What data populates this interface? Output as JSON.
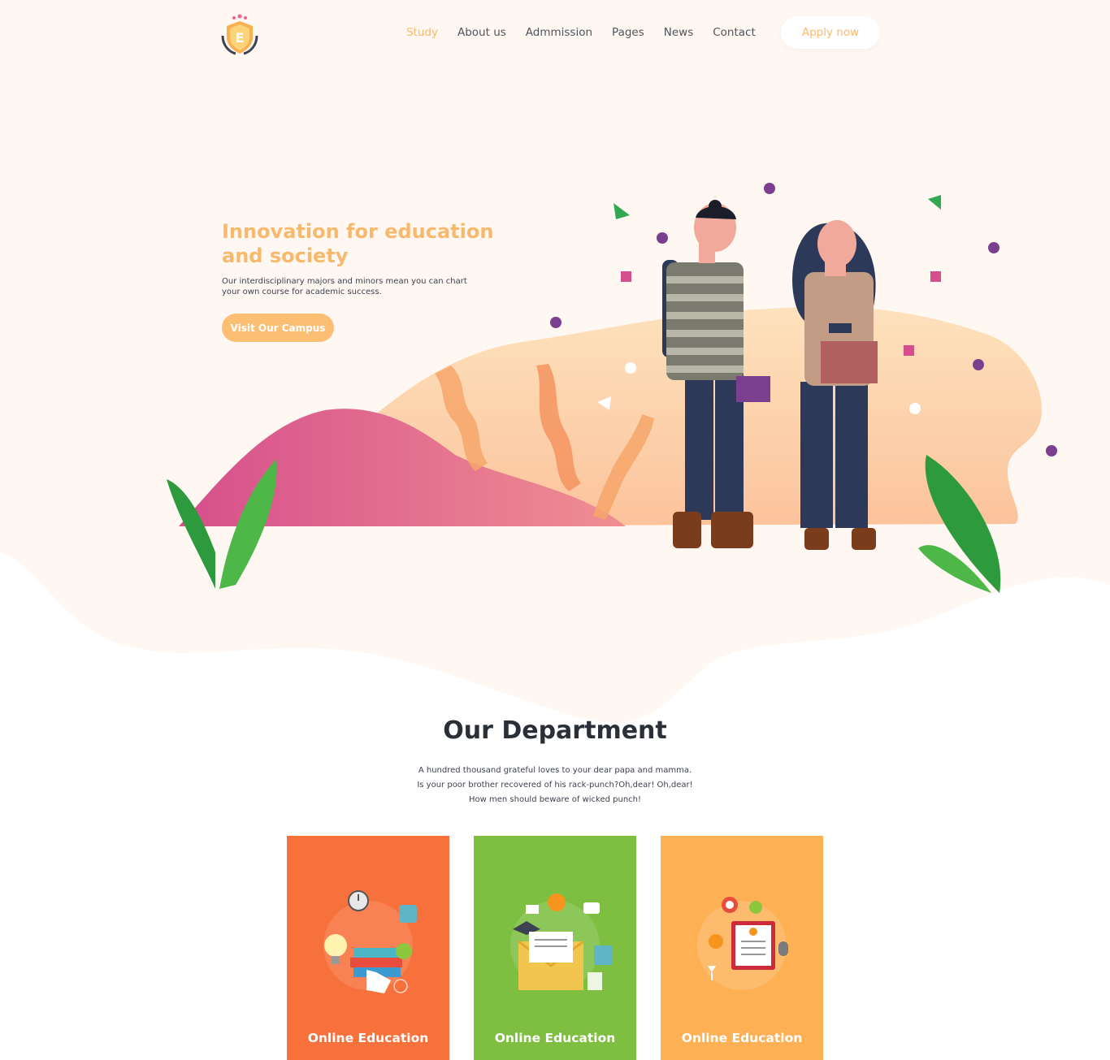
{
  "colors": {
    "accent": "#f9b96c",
    "hero_bg": "#fff8f2",
    "card_orange": "#f7713d",
    "card_green": "#7ebf42",
    "card_amber": "#fdb054",
    "heading": "#2a2f38"
  },
  "brand": {
    "logo_letter": "E"
  },
  "nav": {
    "items": [
      {
        "label": "Study",
        "active": true
      },
      {
        "label": "About us",
        "active": false
      },
      {
        "label": "Admmission",
        "active": false
      },
      {
        "label": "Pages",
        "active": false
      },
      {
        "label": "News",
        "active": false
      },
      {
        "label": "Contact",
        "active": false
      }
    ],
    "apply_label": "Apply now"
  },
  "hero": {
    "title_line1": "Innovation for education",
    "title_line2": "and society",
    "subtitle_line1": "Our interdisciplinary majors and minors mean you can chart",
    "subtitle_line2": "your own course for academic success.",
    "cta_label": "Visit Our Campus"
  },
  "department": {
    "title": "Our Department",
    "desc_lines": [
      "A hundred thousand grateful loves to your dear papa and mamma.",
      "Is your poor brother recovered of his rack-punch?Oh,dear! Oh,dear!",
      "How men should beware of wicked punch!"
    ],
    "cards": [
      {
        "label": "Online Education",
        "icon": "education-books-icon"
      },
      {
        "label": "Online Education",
        "icon": "education-envelope-icon"
      },
      {
        "label": "Online Education",
        "icon": "education-certificate-icon"
      }
    ]
  }
}
